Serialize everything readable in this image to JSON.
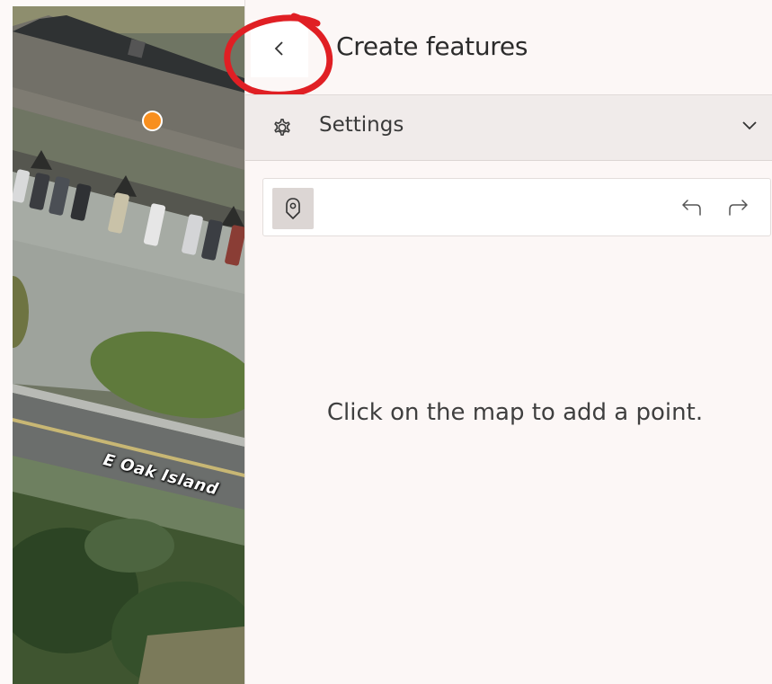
{
  "map": {
    "road_label": "E Oak Island",
    "point_color": "#f88f1f"
  },
  "panel": {
    "title": "Create features",
    "back_icon": "chevron-left-icon",
    "annotation_color": "#e01f24",
    "settings": {
      "label": "Settings",
      "icon": "gear-icon",
      "expand_icon": "chevron-down-icon"
    },
    "toolbar": {
      "tool_icon": "map-pin-icon",
      "undo_icon": "undo-icon",
      "redo_icon": "redo-icon"
    },
    "hint": "Click on the map to add a point."
  }
}
